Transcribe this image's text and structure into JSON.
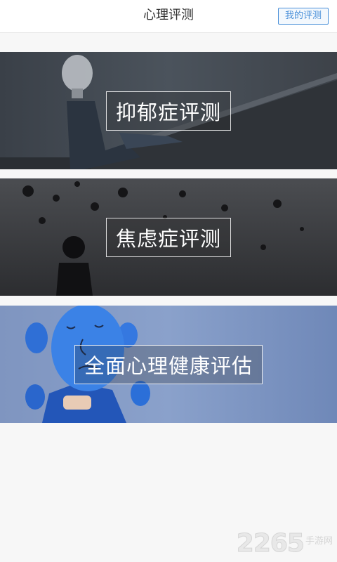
{
  "header": {
    "title": "心理评测",
    "my_eval_label": "我的评测"
  },
  "banners": [
    {
      "label": "抑郁症评测"
    },
    {
      "label": "焦虑症评测"
    },
    {
      "label": "全面心理健康评估"
    }
  ],
  "watermark": {
    "number": "2265",
    "text": "手游网"
  },
  "colors": {
    "accent": "#4a90d9",
    "header_bg": "#ffffff",
    "page_bg": "#f7f7f7"
  }
}
